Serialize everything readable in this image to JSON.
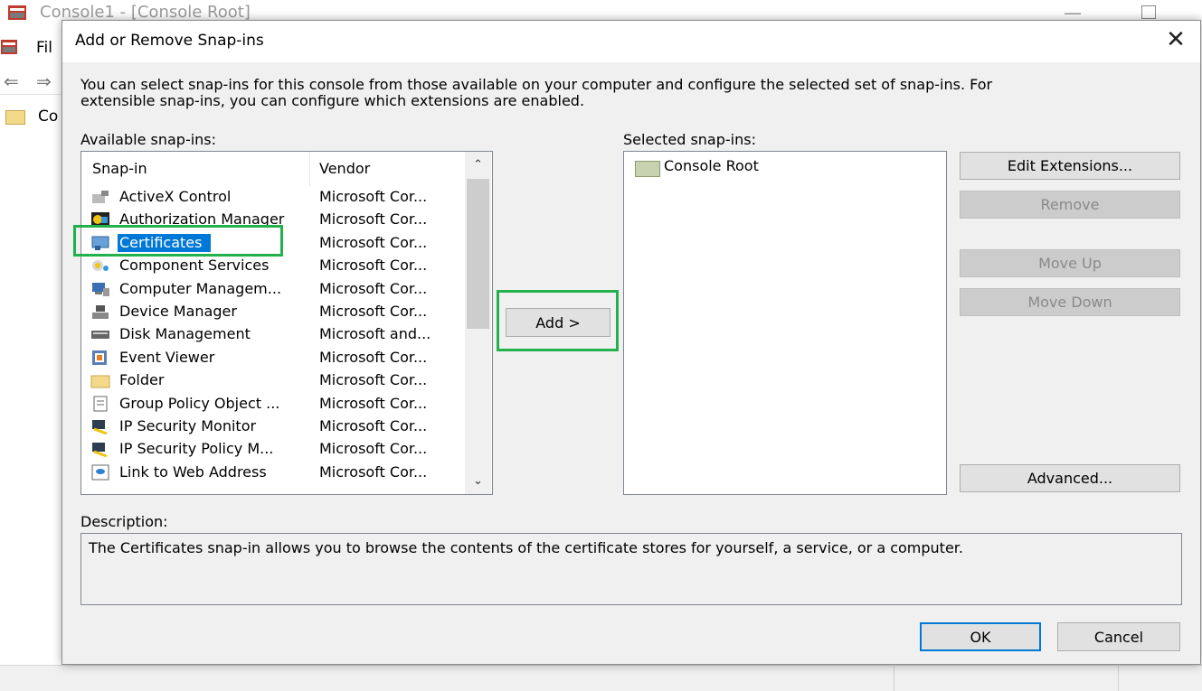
{
  "background": {
    "window_title": "Console1 - [Console Root]",
    "menu_file": "Fil",
    "tree_item": "Co"
  },
  "dialog": {
    "title": "Add or Remove Snap-ins",
    "intro_line1": "You can select snap-ins for this console from those available on your computer and configure the selected set of snap-ins. For",
    "intro_line2": "extensible snap-ins, you can configure which extensions are enabled.",
    "available_label": "Available snap-ins:",
    "selected_label": "Selected snap-ins:",
    "columns": {
      "snapin": "Snap-in",
      "vendor": "Vendor"
    },
    "snapins": [
      {
        "name": "ActiveX Control",
        "vendor": "Microsoft Cor...",
        "icon": "activex-icon"
      },
      {
        "name": "Authorization Manager",
        "vendor": "Microsoft Cor...",
        "icon": "authorization-manager-icon"
      },
      {
        "name": "Certificates",
        "vendor": "Microsoft Cor...",
        "icon": "certificates-icon",
        "selected": true
      },
      {
        "name": "Component Services",
        "vendor": "Microsoft Cor...",
        "icon": "component-services-icon"
      },
      {
        "name": "Computer Managem...",
        "vendor": "Microsoft Cor...",
        "icon": "computer-management-icon"
      },
      {
        "name": "Device Manager",
        "vendor": "Microsoft Cor...",
        "icon": "device-manager-icon"
      },
      {
        "name": "Disk Management",
        "vendor": "Microsoft and...",
        "icon": "disk-management-icon"
      },
      {
        "name": "Event Viewer",
        "vendor": "Microsoft Cor...",
        "icon": "event-viewer-icon"
      },
      {
        "name": "Folder",
        "vendor": "Microsoft Cor...",
        "icon": "folder-icon"
      },
      {
        "name": "Group Policy Object ...",
        "vendor": "Microsoft Cor...",
        "icon": "group-policy-icon"
      },
      {
        "name": "IP Security Monitor",
        "vendor": "Microsoft Cor...",
        "icon": "ip-security-monitor-icon"
      },
      {
        "name": "IP Security Policy M...",
        "vendor": "Microsoft Cor...",
        "icon": "ip-security-policy-icon"
      },
      {
        "name": "Link to Web Address",
        "vendor": "Microsoft Cor...",
        "icon": "web-link-icon"
      }
    ],
    "add_button": "Add >",
    "selected_items": [
      {
        "name": "Console Root",
        "icon": "console-root-folder-icon"
      }
    ],
    "edit_extensions": "Edit Extensions...",
    "remove": "Remove",
    "move_up": "Move Up",
    "move_down": "Move Down",
    "advanced": "Advanced...",
    "description_label": "Description:",
    "description_text": "The Certificates snap-in allows you to browse the contents of the certificate stores for yourself, a service, or a computer.",
    "ok": "OK",
    "cancel": "Cancel",
    "accent_color": "#0078d7",
    "highlight_color": "#22b14c"
  }
}
